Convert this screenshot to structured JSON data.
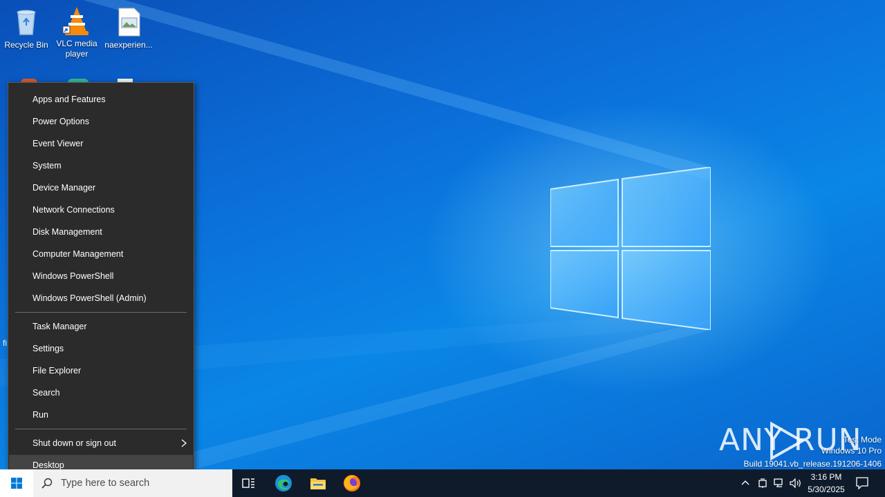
{
  "desktop": {
    "icons": [
      {
        "label": "Recycle Bin",
        "icon": "recycle-bin-icon"
      },
      {
        "label": "VLC media player",
        "icon": "vlc-icon"
      },
      {
        "label": "naexperien...",
        "icon": "image-file-icon"
      }
    ],
    "partial_label": "fi"
  },
  "menu": {
    "group1": [
      "Apps and Features",
      "Power Options",
      "Event Viewer",
      "System",
      "Device Manager",
      "Network Connections",
      "Disk Management",
      "Computer Management",
      "Windows PowerShell",
      "Windows PowerShell (Admin)"
    ],
    "group2": [
      "Task Manager",
      "Settings",
      "File Explorer",
      "Search",
      "Run"
    ],
    "group3": [
      "Shut down or sign out",
      "Desktop"
    ],
    "highlighted": "Desktop"
  },
  "taskbar": {
    "search_placeholder": "Type here to search",
    "time": "3:16 PM",
    "date": "5/30/2025"
  },
  "watermark": {
    "line1": "Test Mode",
    "line2": "Windows 10 Pro",
    "line3": "Build 19041.vb_release.191206-1406",
    "brand": "ANY RUN"
  },
  "colors": {
    "menu_bg": "#2b2b2b",
    "menu_highlight": "#444444",
    "taskbar_bg": "#0f1b2b",
    "desktop_blue": "#0a78e0"
  }
}
